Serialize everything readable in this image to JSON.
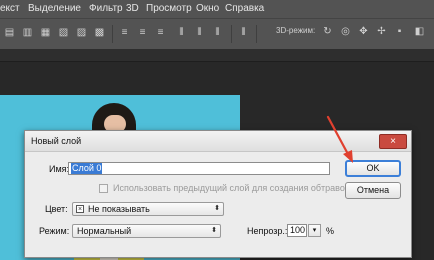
{
  "menubar": {
    "items": [
      "екст",
      "Выделение",
      "Фильтр",
      "3D",
      "Просмотр",
      "Окно",
      "Справка"
    ]
  },
  "optionsbar": {
    "mode_label": "3D-режим:",
    "icons": [
      "align-icon",
      "distribute-icon",
      "3d-rotate-icon",
      "3d-roll-icon",
      "3d-pan-icon",
      "3d-slide-icon",
      "3d-scale-icon"
    ]
  },
  "dialog": {
    "title": "Новый слой",
    "close_label": "×",
    "name_label": "Имя:",
    "name_value": "Слой 0",
    "clip_checkbox_label": "Использовать предыдущий слой для создания обтравочной маски",
    "color_label": "Цвет:",
    "color_value": "Не показывать",
    "color_swatch_glyph": "×",
    "mode_label": "Режим:",
    "mode_value": "Нормальный",
    "opacity_label": "Непрозр.:",
    "opacity_value": "100",
    "opacity_unit": "%",
    "ok_label": "OK",
    "cancel_label": "Отмена"
  },
  "colors": {
    "photo_bg": "#4fbfd9",
    "accent_arrow": "#e0402f",
    "selection": "#3a7bd5"
  }
}
